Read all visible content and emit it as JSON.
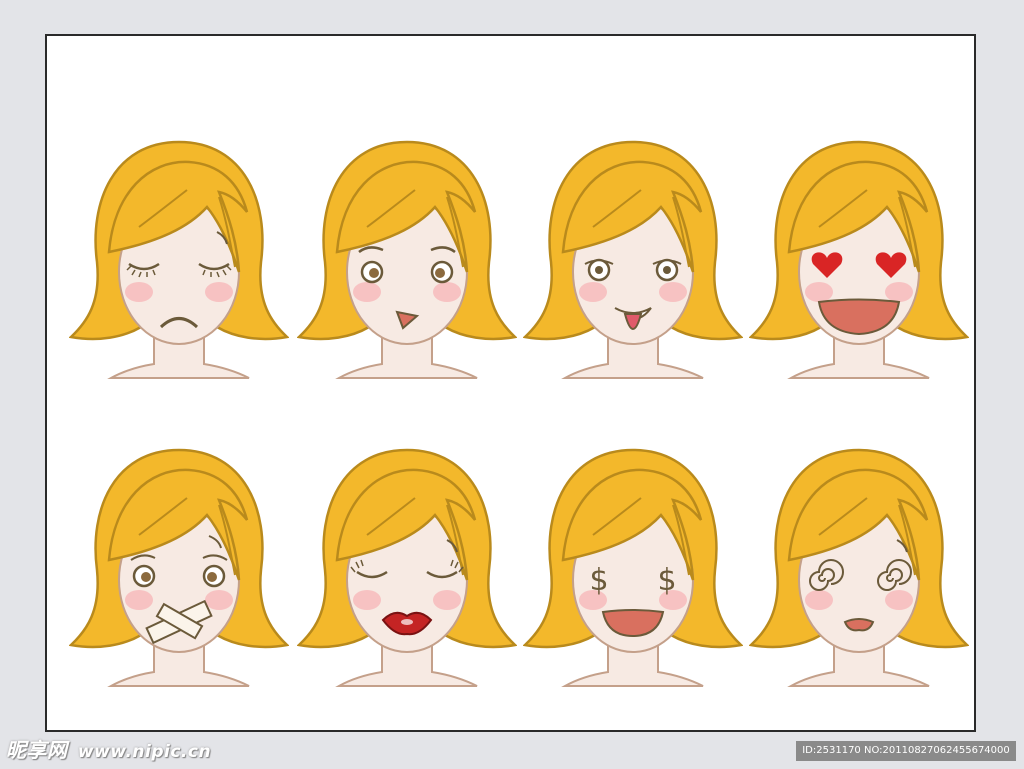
{
  "colors": {
    "hair": "#f3b82b",
    "hair_outline": "#b98a1c",
    "skin": "#f7eae3",
    "skin_outline": "#c4a08a",
    "blush": "#f7c2c2",
    "line": "#6b5a3a",
    "heart": "#d92525",
    "lips": "#c42424",
    "mouth_open": "#d9705f"
  },
  "faces": [
    {
      "label": "sad-closed-eyes",
      "expression": "sad"
    },
    {
      "label": "worried",
      "expression": "worried"
    },
    {
      "label": "tongue-out",
      "expression": "tongue"
    },
    {
      "label": "heart-eyes",
      "expression": "love"
    },
    {
      "label": "taped-mouth",
      "expression": "taped"
    },
    {
      "label": "kiss-lips",
      "expression": "kiss"
    },
    {
      "label": "dollar-eyes",
      "expression": "money"
    },
    {
      "label": "dizzy",
      "expression": "dizzy"
    }
  ],
  "watermark": {
    "brand": "昵享网",
    "url": "www.nipic.cn"
  },
  "id_bar": {
    "text": "ID:2531170 NO:20110827062455674000"
  }
}
